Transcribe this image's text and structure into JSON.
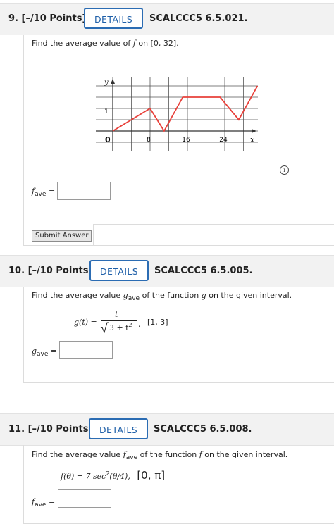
{
  "questions": [
    {
      "number": "9.",
      "points": "[–/10 Points]",
      "details_label": "DETAILS",
      "code": "SCALCCC5 6.5.021.",
      "prompt_pre": "Find the average value of ",
      "prompt_var": "f",
      "prompt_post": " on [0, 32].",
      "answer_label_main": "f",
      "answer_label_sub": "ave",
      "answer_label_eq": " =",
      "answer_value": "",
      "submit_label": "Submit Answer",
      "info_icon": "info-icon",
      "graph": {
        "y_axis_label": "y",
        "x_axis_label": "x",
        "origin_label": "0",
        "y_tick_label": "1",
        "x_tick_labels": [
          "8",
          "16",
          "24"
        ],
        "line_color": "#e8403a",
        "points": [
          [
            0,
            0
          ],
          [
            8,
            2
          ],
          [
            11,
            0
          ],
          [
            15,
            3
          ],
          [
            23,
            3
          ],
          [
            27,
            1
          ],
          [
            31,
            4
          ]
        ]
      }
    },
    {
      "number": "10.",
      "points": "[–/10 Points]",
      "details_label": "DETAILS",
      "code": "SCALCCC5 6.5.005.",
      "prompt_pre": "Find the average value ",
      "prompt_var": "g",
      "prompt_sub": "ave",
      "prompt_mid": " of the function ",
      "prompt_var2": "g",
      "prompt_post": " on the given interval.",
      "formula_lhs": "g(t) =",
      "formula_num": "t",
      "formula_den": "3 + t",
      "formula_den_exp": "2",
      "formula_interval": "[1, 3]",
      "answer_label_main": "g",
      "answer_label_sub": "ave",
      "answer_label_eq": " =",
      "answer_value": ""
    },
    {
      "number": "11.",
      "points": "[–/10 Points]",
      "details_label": "DETAILS",
      "code": "SCALCCC5 6.5.008.",
      "prompt_pre": "Find the average value ",
      "prompt_var": "f",
      "prompt_sub": "ave",
      "prompt_mid": " of the function ",
      "prompt_var2": "f",
      "prompt_post": " on the given interval.",
      "formula_main": "f(θ) = 7 sec",
      "formula_exp": "2",
      "formula_rest": "(θ/4),",
      "formula_interval": "[0, π]",
      "answer_label_main": "f",
      "answer_label_sub": "ave",
      "answer_label_eq": " =",
      "answer_value": ""
    }
  ]
}
